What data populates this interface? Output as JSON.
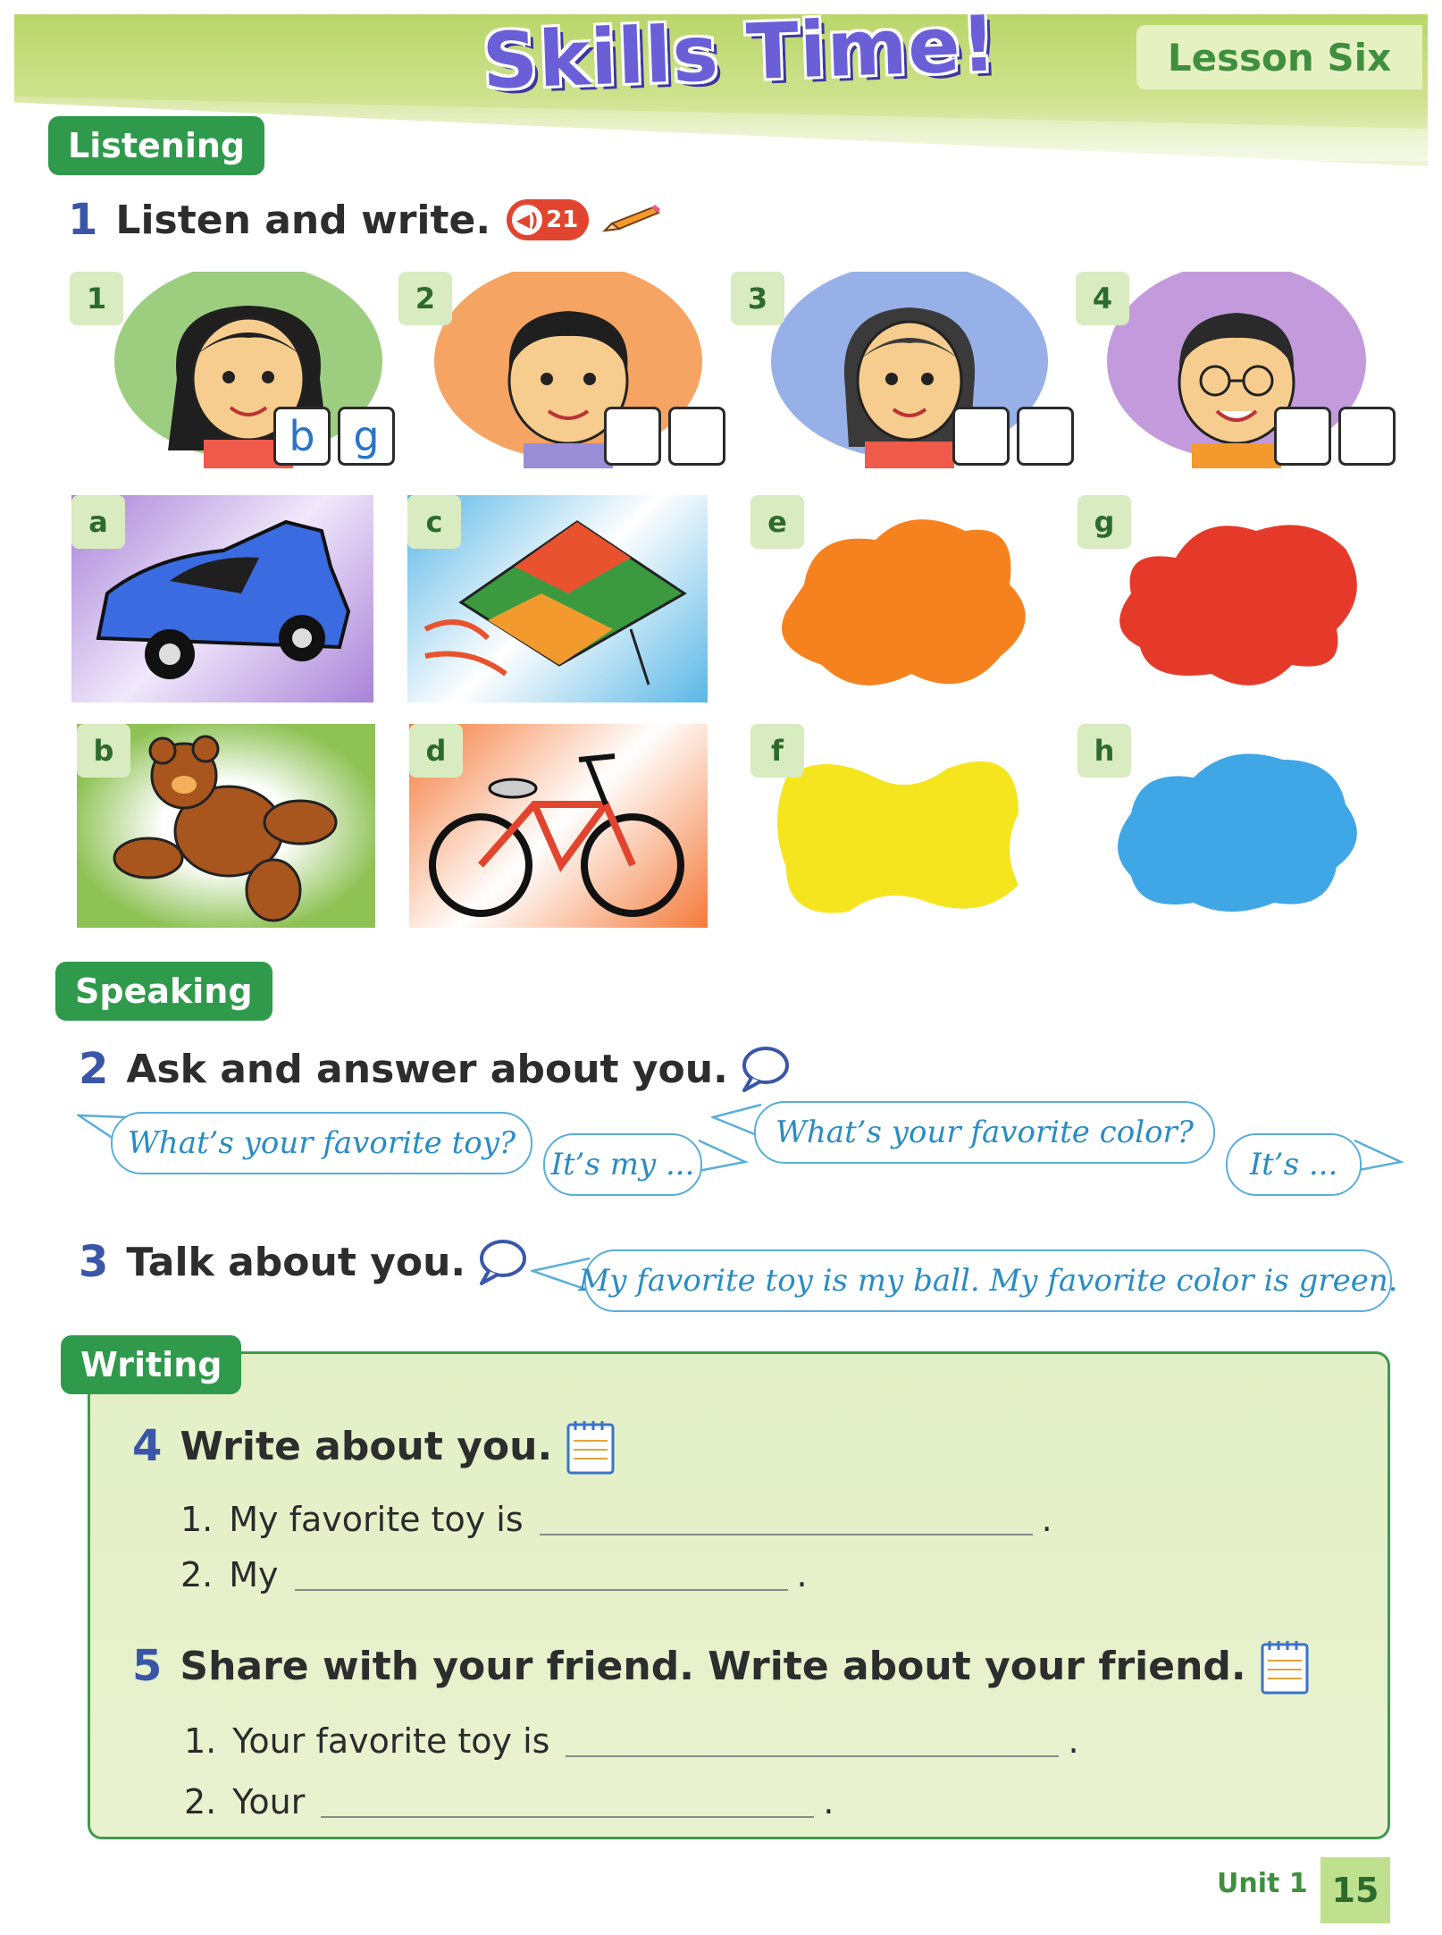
{
  "header": {
    "title": "Skills Time!",
    "lesson": "Lesson Six"
  },
  "listening": {
    "tab": "Listening",
    "exercise": {
      "number": "1",
      "instruction": "Listen and write.",
      "track": "21"
    },
    "kids": [
      {
        "label": "1",
        "answers": [
          "b",
          "g"
        ]
      },
      {
        "label": "2",
        "answers": [
          "",
          ""
        ]
      },
      {
        "label": "3",
        "answers": [
          "",
          ""
        ]
      },
      {
        "label": "4",
        "answers": [
          "",
          ""
        ]
      }
    ],
    "items": [
      {
        "label": "a"
      },
      {
        "label": "b"
      },
      {
        "label": "c"
      },
      {
        "label": "d"
      },
      {
        "label": "e",
        "color": "#f5821f"
      },
      {
        "label": "f",
        "color": "#f5e51f"
      },
      {
        "label": "g",
        "color": "#e53a2a"
      },
      {
        "label": "h",
        "color": "#3fa7e6"
      }
    ]
  },
  "speaking": {
    "tab": "Speaking",
    "ex2": {
      "number": "2",
      "instruction": "Ask and answer about you.",
      "bubbles": [
        "What’s your favorite toy?",
        "It’s my ...",
        "What’s your favorite color?",
        "It’s ..."
      ]
    },
    "ex3": {
      "number": "3",
      "instruction": "Talk about you.",
      "bubble": "My favorite toy is my ball. My favorite color is green."
    }
  },
  "writing": {
    "tab": "Writing",
    "ex4": {
      "number": "4",
      "instruction": "Write about you.",
      "lines": [
        {
          "num": "1.",
          "text": "My favorite toy is"
        },
        {
          "num": "2.",
          "text": "My"
        }
      ]
    },
    "ex5": {
      "number": "5",
      "instruction": "Share with your friend. Write about your friend.",
      "lines": [
        {
          "num": "1.",
          "text": "Your favorite toy is"
        },
        {
          "num": "2.",
          "text": "Your"
        }
      ]
    },
    "period": "."
  },
  "footer": {
    "unit": "Unit 1",
    "page": "15"
  }
}
